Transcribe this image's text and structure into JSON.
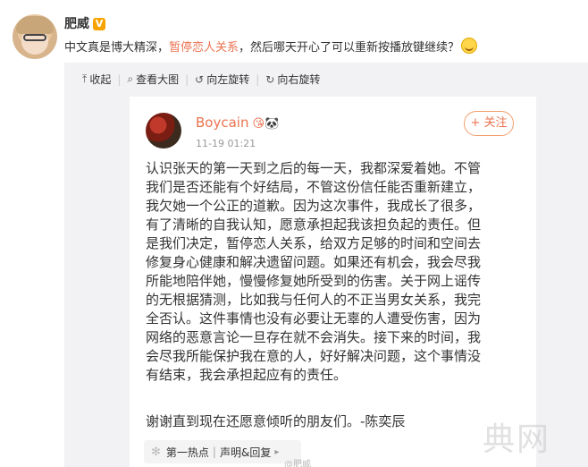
{
  "post": {
    "username": "肥威",
    "verified_badge": "V",
    "text_before": "中文真是博大精深，",
    "text_link": "暂停恋人关系",
    "text_after": "，然后哪天开心了可以重新按播放键继续？",
    "emoji_icon": "smile-emoji"
  },
  "toolbar": {
    "collapse_label": "收起",
    "view_large_label": "查看大图",
    "rotate_left_label": "向左旋转",
    "rotate_right_label": "向右旋转"
  },
  "card": {
    "name": "Boycain",
    "badges": "😘🐼",
    "time": "11-19 01:21",
    "follow_label": "+ 关注",
    "body": "认识张天的第一天到之后的每一天，我都深爱着她。不管\n我们是否还能有个好结局，不管这份信任能否重新建立，\n我欠她一个公正的道歉。因为这次事件，我成长了很多，\n有了清晰的自我认知，愿意承担起我该担负起的责任。但\n是我们决定，暂停恋人关系，给双方足够的时间和空间去\n修复身心健康和解决遗留问题。如果还有机会，我会尽我\n所能地陪伴她，慢慢修复她所受到的伤害。关于网上谣传\n的无根据猜测，比如我与任何人的不正当男女关系，我完\n全否认。这件事情也没有必要让无辜的人遭受伤害，因为\n网络的恶意言论一旦存在就不会消失。接下来的时间，我\n会尽我所能保护我在意的人，好好解决问题，这个事情没\n有结束，我会承担起应有的责任。",
    "sign_off": "谢谢直到现在还愿意倾听的朋友们。-陈奕辰",
    "topic_part1": "第一热点",
    "topic_part2": "声明&回复"
  },
  "watermark": "典网",
  "footmark": "@肥威"
}
